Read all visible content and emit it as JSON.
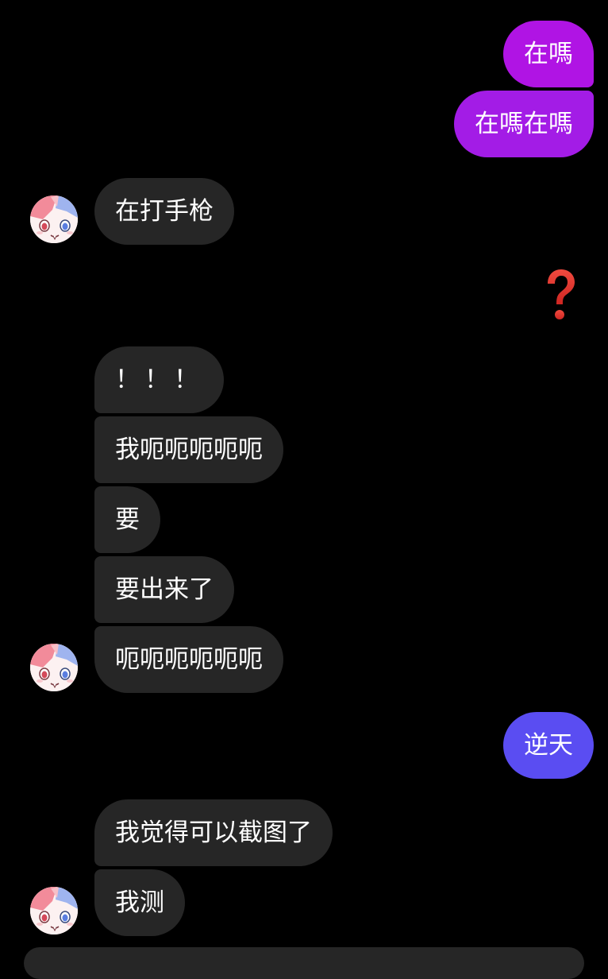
{
  "conversation": {
    "outgoing": {
      "msg1": "在嗎",
      "msg2": "在嗎在嗎",
      "msg3": "逆天"
    },
    "incoming": {
      "msg1": "在打手枪",
      "msg2": "！！！",
      "msg3": "我呃呃呃呃呃",
      "msg4": "要",
      "msg5": "要出来了",
      "msg6": "呃呃呃呃呃呃",
      "msg7": "我觉得可以截图了",
      "msg8": "我测"
    },
    "reaction_icon": "red-question-mark-icon"
  },
  "colors": {
    "background": "#000000",
    "outgoing_gradient_top": "#b012e6",
    "outgoing_gradient_bottom": "#8a2be2",
    "outgoing_blue": "#5b4bf0",
    "incoming_bubble": "#262626",
    "text": "#ffffff",
    "question_mark": "#e0322e"
  }
}
